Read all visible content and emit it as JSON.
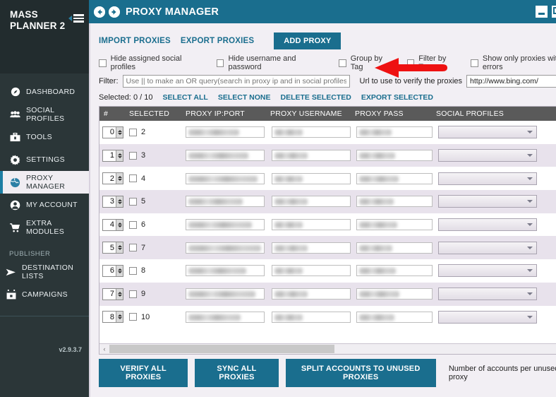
{
  "sidebar": {
    "brand_line1": "MASS",
    "brand_line2": "PLANNER 2",
    "menu_icon": "hamburger-icon",
    "items": [
      {
        "label": "DASHBOARD",
        "icon": "compass-icon",
        "active": false
      },
      {
        "label": "SOCIAL PROFILES",
        "icon": "users-icon",
        "active": false
      },
      {
        "label": "TOOLS",
        "icon": "toolbox-icon",
        "active": false
      },
      {
        "label": "SETTINGS",
        "icon": "gear-icon",
        "active": false
      },
      {
        "label": "PROXY MANAGER",
        "icon": "globe-icon",
        "active": true
      },
      {
        "label": "MY ACCOUNT",
        "icon": "user-circle-icon",
        "active": false
      },
      {
        "label": "EXTRA MODULES",
        "icon": "cart-icon",
        "active": false
      }
    ],
    "publisher_label": "PUBLISHER",
    "publisher_items": [
      {
        "label": "DESTINATION LISTS",
        "icon": "send-icon"
      },
      {
        "label": "CAMPAIGNS",
        "icon": "calendar-icon"
      }
    ],
    "version": "v2.9.3.7"
  },
  "titlebar": {
    "title": "PROXY MANAGER",
    "back_icon": "back-arrow-circle-icon",
    "forward_icon": "forward-arrow-circle-icon",
    "minimize_icon": "minimize-icon",
    "restore_icon": "restore-icon",
    "close_icon": "close-icon",
    "bg_color": "#1a6e8e"
  },
  "toolbar": {
    "import_label": "IMPORT PROXIES",
    "export_label": "EXPORT PROXIES",
    "add_proxy_label": "ADD PROXY",
    "annotation": {
      "shape": "left-arrow",
      "color": "#ee1111"
    },
    "checkboxes": [
      {
        "label": "Hide assigned social profiles",
        "checked": false
      },
      {
        "label": "Hide username and password",
        "checked": false
      },
      {
        "label": "Group by Tag",
        "checked": false
      },
      {
        "label": "Filter by Tag",
        "checked": false
      },
      {
        "label": "Show only proxies with errors",
        "checked": false
      }
    ],
    "filter_label": "Filter:",
    "filter_value": "",
    "filter_placeholder": "Use || to make an OR query(search in proxy ip and in social profiles)",
    "url_label": "Url to use to verify the proxies",
    "url_value": "http://www.bing.com/",
    "selected_label": "Selected:",
    "selected_count": "0 / 10",
    "select_all": "SELECT ALL",
    "select_none": "SELECT NONE",
    "delete_selected": "DELETE SELECTED",
    "export_selected": "EXPORT SELECTED",
    "menu_icon": "hamburger-menu-icon"
  },
  "table": {
    "columns": [
      "#",
      "SELECTED",
      "PROXY IP:PORT",
      "PROXY USERNAME",
      "PROXY PASS",
      "SOCIAL PROFILES"
    ],
    "rows": [
      {
        "num": "0",
        "sel_label": "2",
        "checked": false,
        "ip": "",
        "user": "",
        "pass": "",
        "social": "",
        "alt": false,
        "expanded": false
      },
      {
        "num": "1",
        "sel_label": "3",
        "checked": false,
        "ip": "",
        "user": "",
        "pass": "",
        "social": "",
        "alt": true,
        "expanded": true
      },
      {
        "num": "2",
        "sel_label": "4",
        "checked": false,
        "ip": "",
        "user": "",
        "pass": "",
        "social": "",
        "alt": false,
        "expanded": false
      },
      {
        "num": "3",
        "sel_label": "5",
        "checked": false,
        "ip": "",
        "user": "",
        "pass": "",
        "social": "",
        "alt": true,
        "expanded": true
      },
      {
        "num": "4",
        "sel_label": "6",
        "checked": false,
        "ip": "",
        "user": "",
        "pass": "",
        "social": "",
        "alt": false,
        "expanded": false
      },
      {
        "num": "5",
        "sel_label": "7",
        "checked": false,
        "ip": "",
        "user": "",
        "pass": "",
        "social": "",
        "alt": true,
        "expanded": true
      },
      {
        "num": "6",
        "sel_label": "8",
        "checked": false,
        "ip": "",
        "user": "",
        "pass": "",
        "social": "",
        "alt": false,
        "expanded": false
      },
      {
        "num": "7",
        "sel_label": "9",
        "checked": false,
        "ip": "",
        "user": "",
        "pass": "",
        "social": "",
        "alt": true,
        "expanded": true
      },
      {
        "num": "8",
        "sel_label": "10",
        "checked": false,
        "ip": "",
        "user": "",
        "pass": "",
        "social": "",
        "alt": false,
        "expanded": false
      }
    ],
    "scroll_up_icon": "chevron-up-icon",
    "scroll_down_icon": "chevron-down-icon",
    "scroll_left_icon": "chevron-left-icon",
    "scroll_right_icon": "chevron-right-icon"
  },
  "bottom": {
    "verify_label": "VERIFY ALL PROXIES",
    "sync_label": "SYNC ALL PROXIES",
    "split_label": "SPLIT ACCOUNTS TO UNUSED PROXIES",
    "accounts_label": "Number of accounts per unused proxy",
    "accounts_value": ""
  }
}
